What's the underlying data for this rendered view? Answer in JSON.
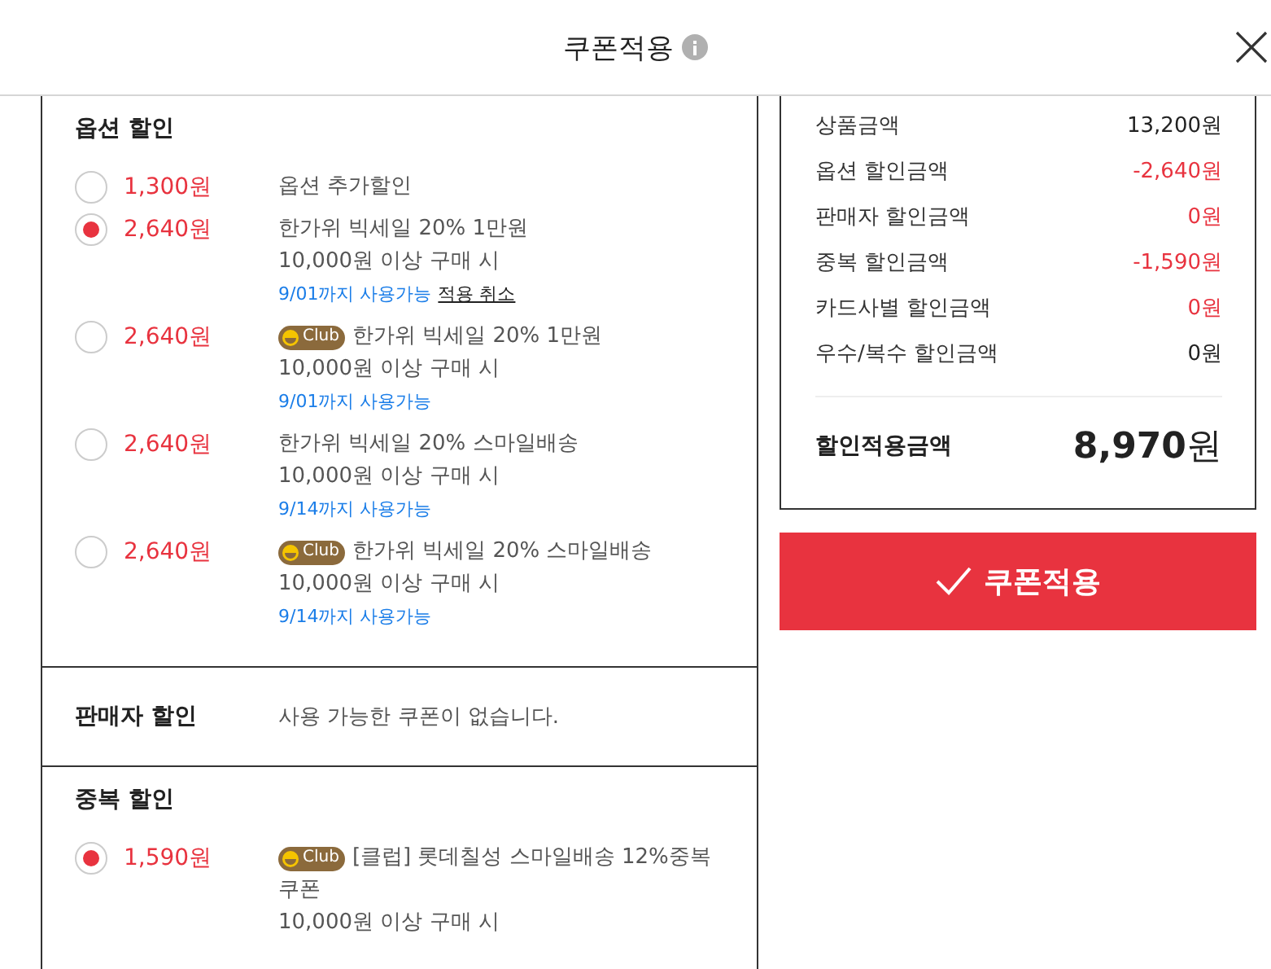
{
  "header": {
    "title": "쿠폰적용"
  },
  "sections": [
    {
      "kind": "list",
      "title": "옵션 할인",
      "coupons": [
        {
          "amount": "1,300원",
          "selected": false,
          "title": "옵션 추가할인"
        },
        {
          "amount": "2,640원",
          "selected": true,
          "title": "한가위 빅세일 20% 1만원",
          "condition": "10,000원 이상 구매 시",
          "expiry": "9/01까지 사용가능",
          "cancel": "적용 취소"
        },
        {
          "amount": "2,640원",
          "selected": false,
          "badge": "Club",
          "title": "한가위 빅세일 20% 1만원",
          "condition": "10,000원 이상 구매 시",
          "expiry": "9/01까지 사용가능"
        },
        {
          "amount": "2,640원",
          "selected": false,
          "title": "한가위 빅세일 20% 스마일배송",
          "condition": "10,000원 이상 구매 시",
          "expiry": "9/14까지 사용가능"
        },
        {
          "amount": "2,640원",
          "selected": false,
          "badge": "Club",
          "title": "한가위 빅세일 20% 스마일배송",
          "condition": "10,000원 이상 구매 시",
          "expiry": "9/14까지 사용가능"
        }
      ]
    },
    {
      "kind": "empty",
      "title": "판매자 할인",
      "message": "사용 가능한 쿠폰이 없습니다."
    },
    {
      "kind": "list",
      "title": "중복 할인",
      "coupons": [
        {
          "amount": "1,590원",
          "selected": true,
          "badge": "Club",
          "title": "[클럽] 롯데칠성 스마일배송 12%중복",
          "title_wrap": "쿠폰",
          "condition": "10,000원 이상 구매 시"
        }
      ]
    }
  ],
  "summary": {
    "rows": [
      {
        "label": "상품금액",
        "value": "13,200원",
        "kind": "plain"
      },
      {
        "label": "옵션 할인금액",
        "value": "-2,640원",
        "kind": "discount"
      },
      {
        "label": "판매자 할인금액",
        "value": "0원",
        "kind": "discount"
      },
      {
        "label": "중복 할인금액",
        "value": "-1,590원",
        "kind": "discount"
      },
      {
        "label": "카드사별 할인금액",
        "value": "0원",
        "kind": "discount"
      },
      {
        "label": "우수/복수 할인금액",
        "value": "0원",
        "kind": "plain"
      }
    ],
    "total_label": "할인적용금액",
    "total_value": "8,970",
    "total_unit": "원"
  },
  "apply_button": "쿠폰적용"
}
